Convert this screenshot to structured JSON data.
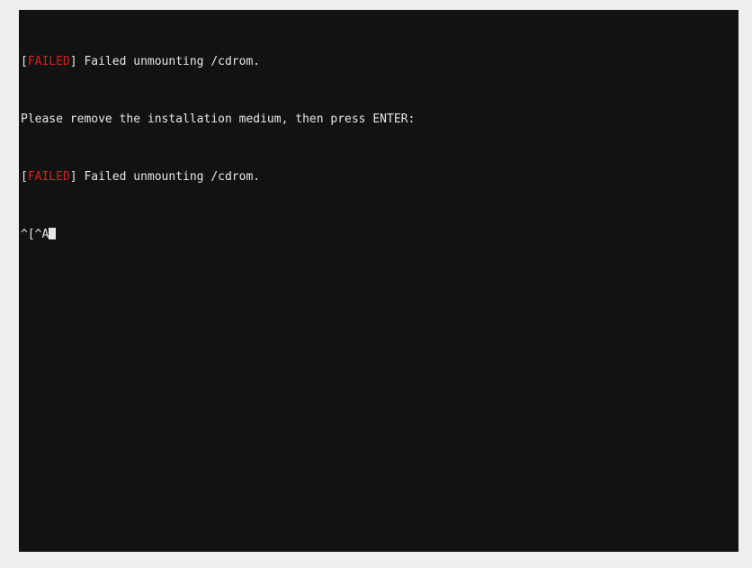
{
  "window": {
    "type": "terminal-console",
    "background_color": "#121212",
    "page_background_color": "#efefef",
    "foreground_color": "#e6e6e6",
    "error_color": "#dc1f1f"
  },
  "console": {
    "lines": [
      {
        "id": "line-1",
        "kind": "status",
        "bracket_open": "[",
        "status": "FAILED",
        "bracket_close": "]",
        "message": " Failed unmounting /cdrom."
      },
      {
        "id": "line-2",
        "kind": "prompt",
        "message": "Please remove the installation medium, then press ENTER:"
      },
      {
        "id": "line-3",
        "kind": "status",
        "bracket_open": "[",
        "status": "FAILED",
        "bracket_close": "]",
        "message": " Failed unmounting /cdrom."
      },
      {
        "id": "line-4",
        "kind": "input",
        "message": "^[^A"
      }
    ]
  }
}
